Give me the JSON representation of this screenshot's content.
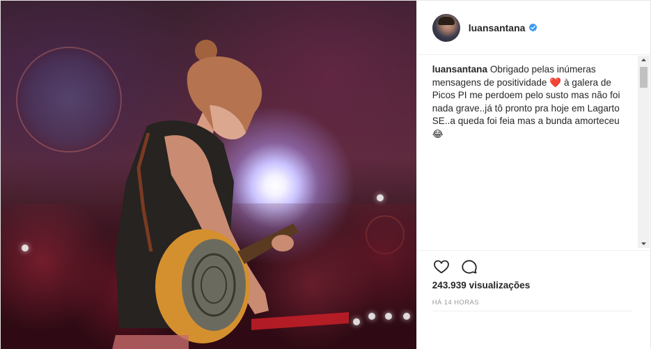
{
  "post": {
    "username": "luansantana",
    "verified": true,
    "verified_icon": "verified-badge-icon",
    "caption": {
      "username": "luansantana",
      "text_part1": "Obrigado pelas inúmeras mensagens de positividade",
      "emoji1": "❤️",
      "text_part2": "à galera de Picos PI me perdoem pelo susto mas não foi nada grave..já tô pronto pra hoje em Lagarto SE..a queda foi feia mas a bunda amorteceu",
      "emoji2": "😂"
    },
    "actions": {
      "like_icon": "heart-outline-icon",
      "comment_icon": "comment-bubble-icon"
    },
    "views": "243.939 visualizações",
    "time_ago": "HÁ 14 HORAS"
  },
  "colors": {
    "text": "#262626",
    "muted": "#999999",
    "verified_blue": "#3897f0",
    "border": "#efefef"
  }
}
